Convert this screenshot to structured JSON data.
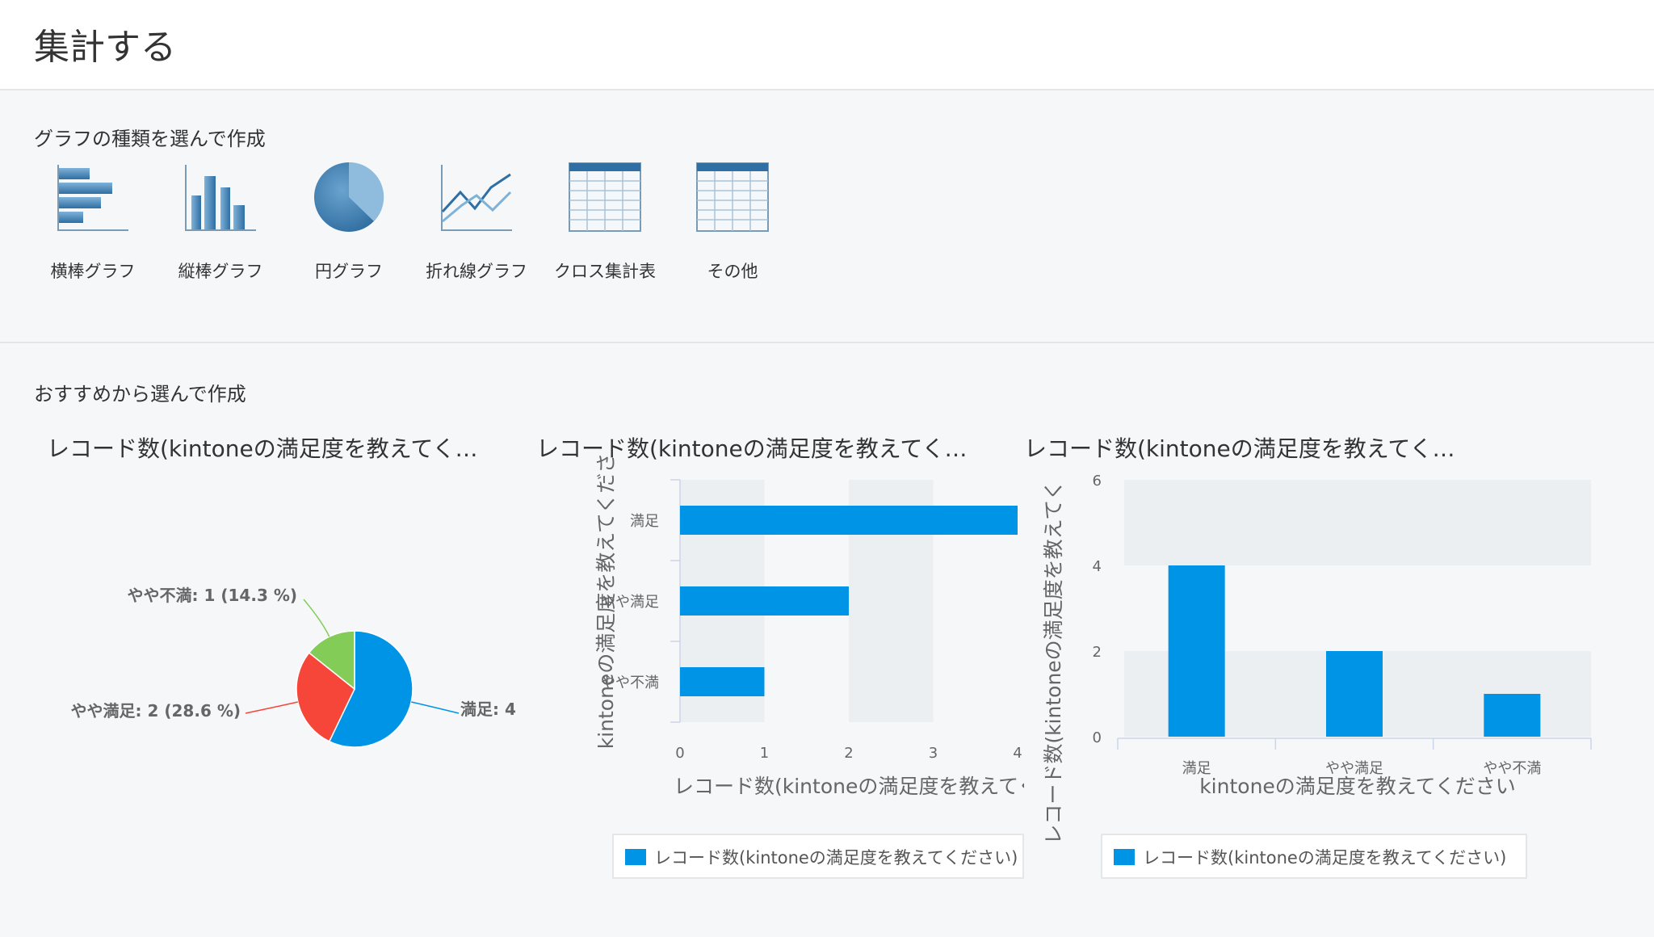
{
  "header": {
    "title": "集計する"
  },
  "graph_types": {
    "title": "グラフの種類を選んで作成",
    "items": [
      {
        "label": "横棒グラフ",
        "icon": "horizontal-bar-chart-icon"
      },
      {
        "label": "縦棒グラフ",
        "icon": "vertical-bar-chart-icon"
      },
      {
        "label": "円グラフ",
        "icon": "pie-chart-icon"
      },
      {
        "label": "折れ線グラフ",
        "icon": "line-chart-icon"
      },
      {
        "label": "クロス集計表",
        "icon": "cross-table-icon"
      },
      {
        "label": "その他",
        "icon": "table-icon"
      }
    ]
  },
  "recommended": {
    "title": "おすすめから選んで作成",
    "cards": [
      {
        "title": "レコード数(kintoneの満足度を教えてく…"
      },
      {
        "title": "レコード数(kintoneの満足度を教えてく…"
      },
      {
        "title": "レコード数(kintoneの満足度を教えてく…"
      }
    ]
  },
  "colors": {
    "accent": "#0094e7",
    "red": "#f6463a",
    "green": "#83cc57",
    "plot_band": "#eceff1"
  },
  "chart_data": [
    {
      "type": "pie",
      "categories": [
        "満足",
        "やや満足",
        "やや不満"
      ],
      "values": [
        4,
        2,
        1
      ],
      "labels": [
        "満足: 4",
        "やや満足: 2 (28.6 %)",
        "やや不満: 1 (14.3 %)"
      ],
      "colors": [
        "#0094e7",
        "#f6463a",
        "#83cc57"
      ]
    },
    {
      "type": "bar",
      "orientation": "horizontal",
      "categories": [
        "満足",
        "やや満足",
        "やや不満"
      ],
      "values": [
        4,
        2,
        1
      ],
      "xlim": [
        0,
        4
      ],
      "xticks": [
        "0",
        "1",
        "2",
        "3",
        "4"
      ],
      "xlabel": "レコード数(kintoneの満足度を教えてく",
      "ylabel": "kintoneの満足度を教えてくださ",
      "legend": "レコード数(kintoneの満足度を教えてください)"
    },
    {
      "type": "bar",
      "orientation": "vertical",
      "categories": [
        "満足",
        "やや満足",
        "やや不満"
      ],
      "values": [
        4,
        2,
        1
      ],
      "ylim": [
        0,
        6
      ],
      "yticks": [
        "0",
        "2",
        "4",
        "6"
      ],
      "xlabel": "kintoneの満足度を教えてください",
      "ylabel": "レコード数(kintoneの満足度を教えてく",
      "legend": "レコード数(kintoneの満足度を教えてください)"
    }
  ]
}
